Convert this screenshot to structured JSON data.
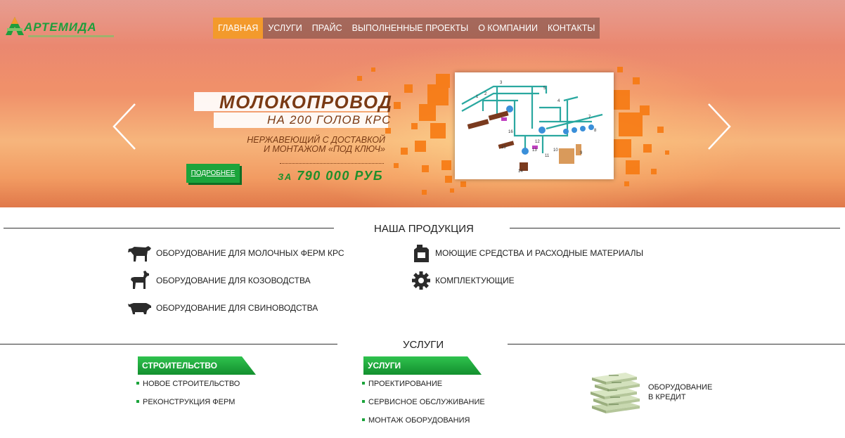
{
  "header": {
    "logo_text": "АРТЕМИДА",
    "nav": [
      {
        "label": "ГЛАВНАЯ",
        "active": true
      },
      {
        "label": "УСЛУГИ",
        "active": false
      },
      {
        "label": "ПРАЙС",
        "active": false
      },
      {
        "label": "ВЫПОЛНЕННЫЕ ПРОЕКТЫ",
        "active": false
      },
      {
        "label": "О КОМПАНИИ",
        "active": false
      },
      {
        "label": "КОНТАКТЫ",
        "active": false
      }
    ]
  },
  "slider": {
    "title": "МОЛОКОПРОВОД",
    "subtitle": "НА  200 ГОЛОВ КРС",
    "description_line1": "НЕРЖАВЕЮЩИЙ С ДОСТАВКОЙ",
    "description_line2": "И МОНТАЖОМ «ПОД КЛЮЧ»",
    "price_prefix": "ЗА",
    "price": "790 000 РУБ",
    "more_button": "ПОДРОБНЕЕ",
    "prev_icon": "chevron-left-icon",
    "next_icon": "chevron-right-icon"
  },
  "products": {
    "title": "НАША ПРОДУКЦИЯ",
    "items": [
      {
        "icon": "cow-icon",
        "label": "ОБОРУДОВАНИЕ ДЛЯ МОЛОЧНЫХ ФЕРМ КРС"
      },
      {
        "icon": "goat-icon",
        "label": "ОБОРУДОВАНИЕ ДЛЯ КОЗОВОДСТВА"
      },
      {
        "icon": "pig-icon",
        "label": "ОБОРУДОВАНИЕ ДЛЯ СВИНОВОДСТВА"
      },
      {
        "icon": "canister-icon",
        "label": "МОЮЩИЕ СРЕДСТВА И РАСХОДНЫЕ МАТЕРИАЛЫ"
      },
      {
        "icon": "gear-icon",
        "label": "КОМПЛЕКТУЮЩИЕ"
      }
    ]
  },
  "services": {
    "title": "УСЛУГИ",
    "construction": {
      "label": "СТРОИТЕЛЬСТВО",
      "items": [
        "НОВОЕ СТРОИТЕЛЬСТВО",
        "РЕКОНСТРУКЦИЯ ФЕРМ"
      ]
    },
    "services": {
      "label": "УСЛУГИ",
      "items": [
        "ПРОЕКТИРОВАНИЕ",
        "СЕРВИСНОЕ ОБСЛУЖИВАНИЕ",
        "МОНТАЖ ОБОРУДОВАНИЯ"
      ]
    },
    "credit": {
      "icon": "money-stack-icon",
      "line1": "ОБОРУДОВАНИЕ",
      "line2": "В КРЕДИТ"
    }
  },
  "colors": {
    "accent_orange": "#f39a2c",
    "brand_green": "#1ba43b",
    "price_green": "#1f8f2b",
    "title_brown": "#7a3a14"
  }
}
